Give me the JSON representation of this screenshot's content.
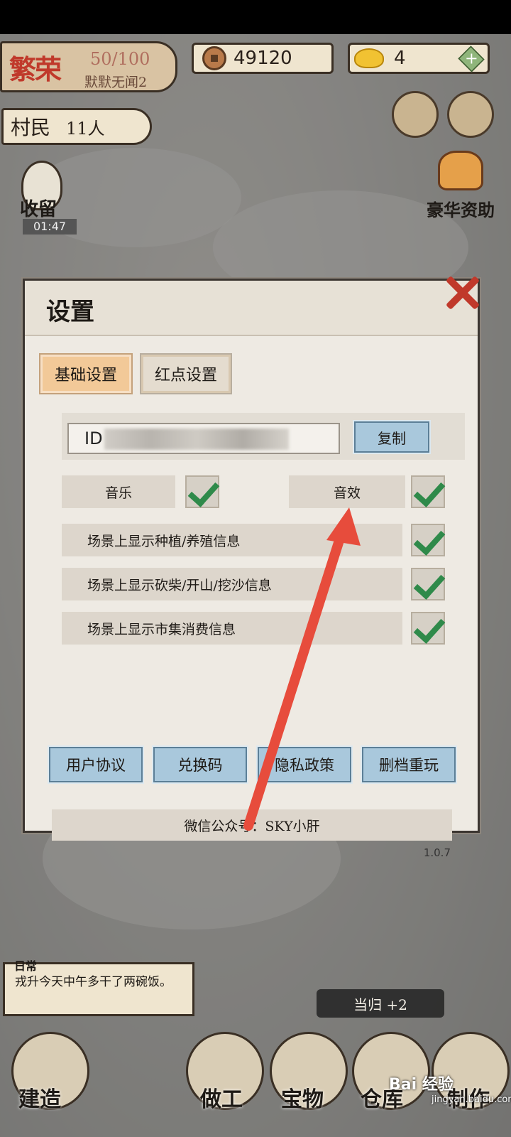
{
  "hud": {
    "prosperity_label": "繁荣",
    "prosperity_value": "50/100",
    "player_name": "默默无闻2",
    "coins": "49120",
    "gold": "4",
    "villager_label": "村民",
    "villager_count": "11人"
  },
  "side": {
    "retain_label": "收留",
    "retain_timer": "01:47",
    "gift_label": "豪华资助"
  },
  "dialog": {
    "title": "设置",
    "tabs": [
      {
        "label": "基础设置",
        "active": true
      },
      {
        "label": "红点设置",
        "active": false
      }
    ],
    "id_prefix": "ID",
    "copy_label": "复制",
    "music_label": "音乐",
    "sfx_label": "音效",
    "options": [
      {
        "label": "场景上显示种植/养殖信息",
        "checked": true
      },
      {
        "label": "场景上显示砍柴/开山/挖沙信息",
        "checked": true
      },
      {
        "label": "场景上显示市集消费信息",
        "checked": true
      }
    ],
    "buttons": [
      "用户协议",
      "兑换码",
      "隐私政策",
      "删档重玩"
    ],
    "wechat": "微信公众号：SKY小肝",
    "version": "1.0.7"
  },
  "bottom": {
    "daily_tag": "日常",
    "daily_text": "戎升今天中午多干了两碗饭。",
    "toast": "当归 +2",
    "dock": [
      "建造",
      "做工",
      "宝物",
      "仓库",
      "制作"
    ],
    "watermark": "Bai 经验",
    "watermark_url": "jingyan.baidu.com"
  }
}
